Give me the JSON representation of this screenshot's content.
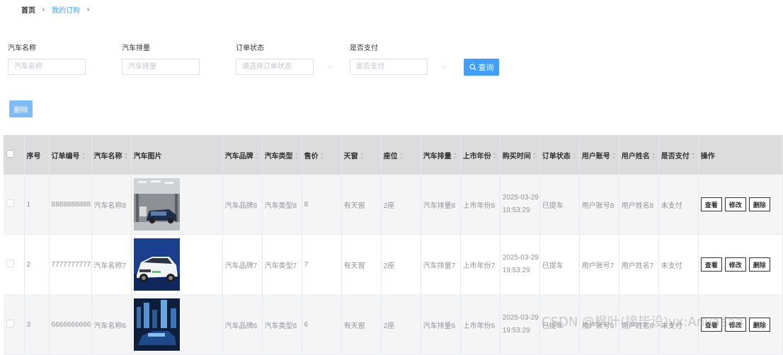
{
  "breadcrumb": {
    "home": "首页",
    "separator": "›",
    "current": "我的订购"
  },
  "filters": [
    {
      "label": "汽车名称",
      "placeholder": "汽车名称",
      "type": "input"
    },
    {
      "label": "汽车排量",
      "placeholder": "汽车排量",
      "type": "input"
    },
    {
      "label": "订单状态",
      "placeholder": "请选择订单状态",
      "type": "select"
    },
    {
      "label": "是否支付",
      "placeholder": "是否支付",
      "type": "select"
    }
  ],
  "search_button": "查询",
  "delete_button": "删除",
  "icons": {
    "search": "search-icon",
    "dropdown": "chevron-down-icon"
  },
  "colors": {
    "primary": "#409eff",
    "header_bg": "#dcdcdc"
  },
  "table": {
    "columns": [
      "序号",
      "订单编号",
      "汽车名称",
      "汽车图片",
      "汽车品牌",
      "汽车类型",
      "售价",
      "天窗",
      "座位",
      "汽车排量",
      "上市年份",
      "购买时间",
      "订单状态",
      "用户账号",
      "用户姓名",
      "是否支付",
      "操作"
    ],
    "actions": {
      "view": "查看",
      "edit": "修改",
      "delete": "删除"
    },
    "rows": [
      {
        "index": "1",
        "order_no": "8888888888",
        "car_name": "汽车名称8",
        "brand": "汽车品牌8",
        "type": "汽车类型8",
        "price": "8",
        "sunroof": "有天窗",
        "seats": "2座",
        "displacement": "汽车排量8",
        "year": "上市年份8",
        "date": "2025-03-29",
        "time": "19:53:29",
        "status": "已提车",
        "account": "用户账号8",
        "username": "用户姓名8",
        "paid": "未支付"
      },
      {
        "index": "2",
        "order_no": "7777777777",
        "car_name": "汽车名称7",
        "brand": "汽车品牌7",
        "type": "汽车类型7",
        "price": "7",
        "sunroof": "有天窗",
        "seats": "2座",
        "displacement": "汽车排量7",
        "year": "上市年份7",
        "date": "2025-03-29",
        "time": "19:53:29",
        "status": "已提车",
        "account": "用户账号7",
        "username": "用户姓名7",
        "paid": "未支付"
      },
      {
        "index": "3",
        "order_no": "6666666666",
        "car_name": "汽车名称6",
        "brand": "汽车品牌6",
        "type": "汽车类型6",
        "price": "6",
        "sunroof": "有天窗",
        "seats": "2座",
        "displacement": "汽车排量6",
        "year": "上市年份6",
        "date": "2025-03-29",
        "time": "19:53:29",
        "status": "已提车",
        "account": "用户账号6",
        "username": "用户姓名6",
        "paid": "未支付"
      }
    ]
  },
  "watermark": "CSDN @枫叶(接毕设)vx:Anyaaaa"
}
